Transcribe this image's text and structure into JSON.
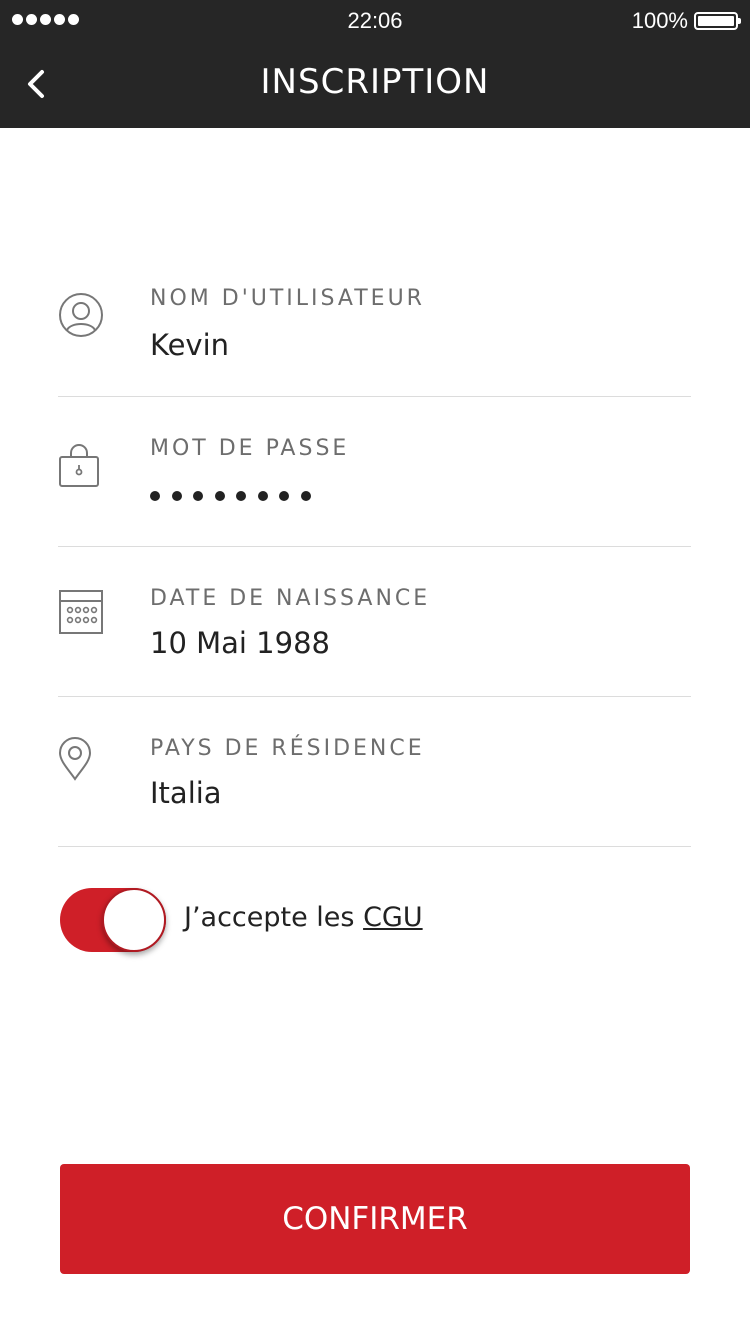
{
  "status_bar": {
    "time": "22:06",
    "battery_percent": "100%",
    "signal_dots": 5
  },
  "header": {
    "title": "INSCRIPTION",
    "back_icon": "chevron-left-icon"
  },
  "fields": {
    "username": {
      "icon": "user-icon",
      "label": "NOM D'UTILISATEUR",
      "value": "Kevin"
    },
    "password": {
      "icon": "lock-icon",
      "label": "MOT DE PASSE",
      "masked_length": 8
    },
    "birthdate": {
      "icon": "calendar-icon",
      "label": "DATE DE NAISSANCE",
      "value": "10 Mai 1988"
    },
    "country": {
      "icon": "location-pin-icon",
      "label": "PAYS DE RÉSIDENCE",
      "value": "Italia"
    }
  },
  "terms": {
    "toggle_on": true,
    "text": "J’accepte les ",
    "link": "CGU"
  },
  "confirm": {
    "label": "CONFIRMER"
  },
  "colors": {
    "header_bg": "#262626",
    "accent": "#cf1f28",
    "label": "#6d6d6d",
    "value": "#222222",
    "divider": "#dcdcdc"
  }
}
